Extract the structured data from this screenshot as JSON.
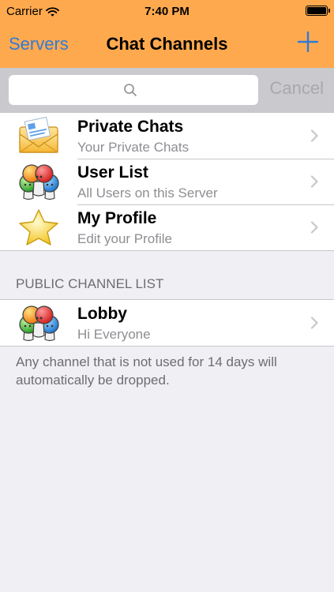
{
  "status_bar": {
    "carrier": "Carrier",
    "time": "7:40 PM"
  },
  "nav": {
    "back_label": "Servers",
    "title": "Chat Channels",
    "add_icon": "plus-icon"
  },
  "search": {
    "placeholder": "",
    "cancel_label": "Cancel"
  },
  "menu": {
    "items": [
      {
        "title": "Private Chats",
        "subtitle": "Your Private Chats",
        "icon": "envelope-icon"
      },
      {
        "title": "User List",
        "subtitle": "All Users on this Server",
        "icon": "users-icon"
      },
      {
        "title": "My Profile",
        "subtitle": "Edit your Profile",
        "icon": "star-icon"
      }
    ]
  },
  "public_channels": {
    "header": "PUBLIC CHANNEL LIST",
    "items": [
      {
        "title": "Lobby",
        "subtitle": "Hi Everyone",
        "icon": "users-icon"
      }
    ],
    "footer": "Any channel that is not used for 14 days will automatically be dropped."
  },
  "colors": {
    "nav_bar": "#ffa94e",
    "tint": "#2f7bd8",
    "background": "#efeff4",
    "search_bar": "#c9c9ce"
  }
}
